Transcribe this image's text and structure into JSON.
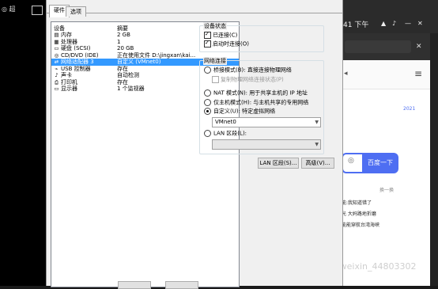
{
  "tabs": [
    "硬件",
    "选项"
  ],
  "device_list": {
    "header_device": "设备",
    "header_summary": "摘要",
    "rows": [
      {
        "icon": "memory-icon",
        "name": "内存",
        "summary": "2 GB"
      },
      {
        "icon": "cpu-icon",
        "name": "处理器",
        "summary": "1"
      },
      {
        "icon": "disk-icon",
        "name": "硬盘 (SCSI)",
        "summary": "20 GB"
      },
      {
        "icon": "cd-icon",
        "name": "CD/DVD (IDE)",
        "summary": "正在使用文件 D:\\jingxan\\kai..."
      },
      {
        "icon": "network-icon",
        "name": "网络适配器 3",
        "summary": "自定义 (VMnet0)"
      },
      {
        "icon": "usb-icon",
        "name": "USB 控制器",
        "summary": "存在"
      },
      {
        "icon": "sound-icon",
        "name": "声卡",
        "summary": "自动检测"
      },
      {
        "icon": "printer-icon",
        "name": "打印机",
        "summary": "存在"
      },
      {
        "icon": "monitor-icon",
        "name": "显示器",
        "summary": "1 个监视器"
      }
    ]
  },
  "device_status": {
    "legend": "设备状态",
    "connected": "已连接(C)",
    "connect_at_power_on": "启动时连接(O)"
  },
  "network_connection": {
    "legend": "网络连接",
    "bridged": "桥接模式(B): 直接连接物理网络",
    "replicate": "复制物理网络连接状态(P)",
    "nat": "NAT 模式(N): 用于共享主机的 IP 地址",
    "host_only": "仅主机模式(H): 与主机共享的专用网络",
    "custom": "自定义(U): 特定虚拟网络",
    "custom_value": "VMnet0",
    "lan_segment": "LAN 区段(L):"
  },
  "buttons": {
    "lan_segments": "LAN 区段(S)...",
    "advanced": "高级(V)..."
  },
  "background": {
    "left_text": "◎ 超",
    "clock": "41 下午",
    "news_label": "2021",
    "search_button": "百度一下",
    "refresh": "换一换",
    "hot1": "能:我知道错了",
    "hot2": "光 大妈路地折磨",
    "hot3": "能能穿航台湾海峡",
    "watermark": "https://blog.csdn.net/weixin_44803302"
  }
}
